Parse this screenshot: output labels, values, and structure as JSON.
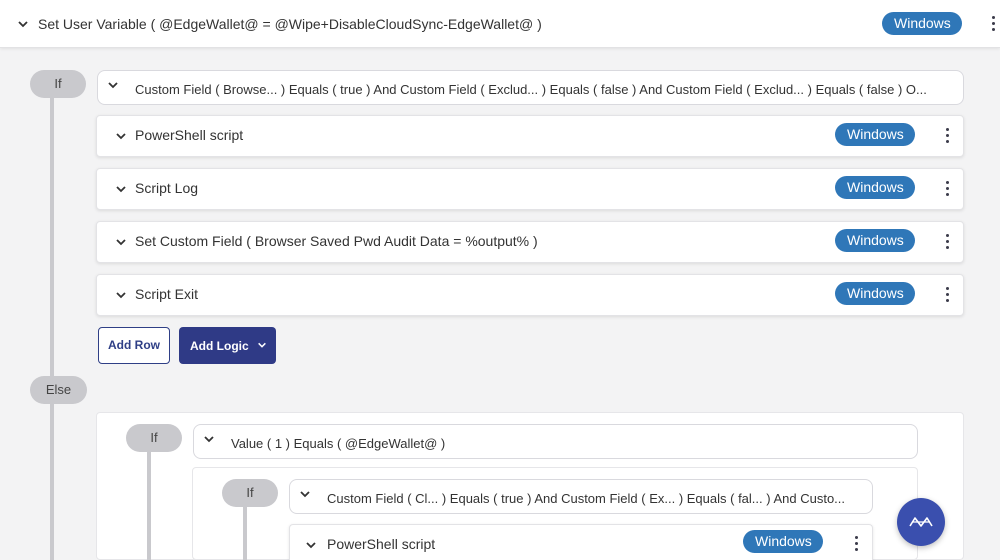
{
  "top_row": {
    "title": "Set User Variable ( @EdgeWallet@ = @Wipe+DisableCloudSync-EdgeWallet@ )",
    "badge": "Windows"
  },
  "if_block": {
    "pill": "If",
    "condition": "Custom Field ( Browse... ) Equals ( true ) And Custom Field ( Exclud... ) Equals ( false ) And Custom Field ( Exclud... ) Equals ( false ) O...",
    "rows": [
      {
        "title": "PowerShell script",
        "badge": "Windows"
      },
      {
        "title": "Script Log",
        "badge": "Windows"
      },
      {
        "title": "Set Custom Field ( Browser Saved Pwd Audit Data = %output% )",
        "badge": "Windows"
      },
      {
        "title": "Script Exit",
        "badge": "Windows"
      }
    ],
    "add_row": "Add Row",
    "add_logic": "Add Logic"
  },
  "else_block": {
    "pill": "Else",
    "nested_if": {
      "pill": "If",
      "condition": "Value ( 1 ) Equals ( @EdgeWallet@ )",
      "inner_if": {
        "pill": "If",
        "condition": "Custom Field ( Cl... ) Equals ( true ) And Custom Field ( Ex... ) Equals ( fal... ) And Custo...",
        "rows": [
          {
            "title": "PowerShell script",
            "badge": "Windows"
          }
        ]
      }
    }
  },
  "fab": {
    "icon": "wave-logo-icon"
  },
  "colors": {
    "badge": "#2f77b8",
    "primary_button": "#2f3a86",
    "fab": "#3a4fae",
    "pill": "#c9c9cd"
  }
}
